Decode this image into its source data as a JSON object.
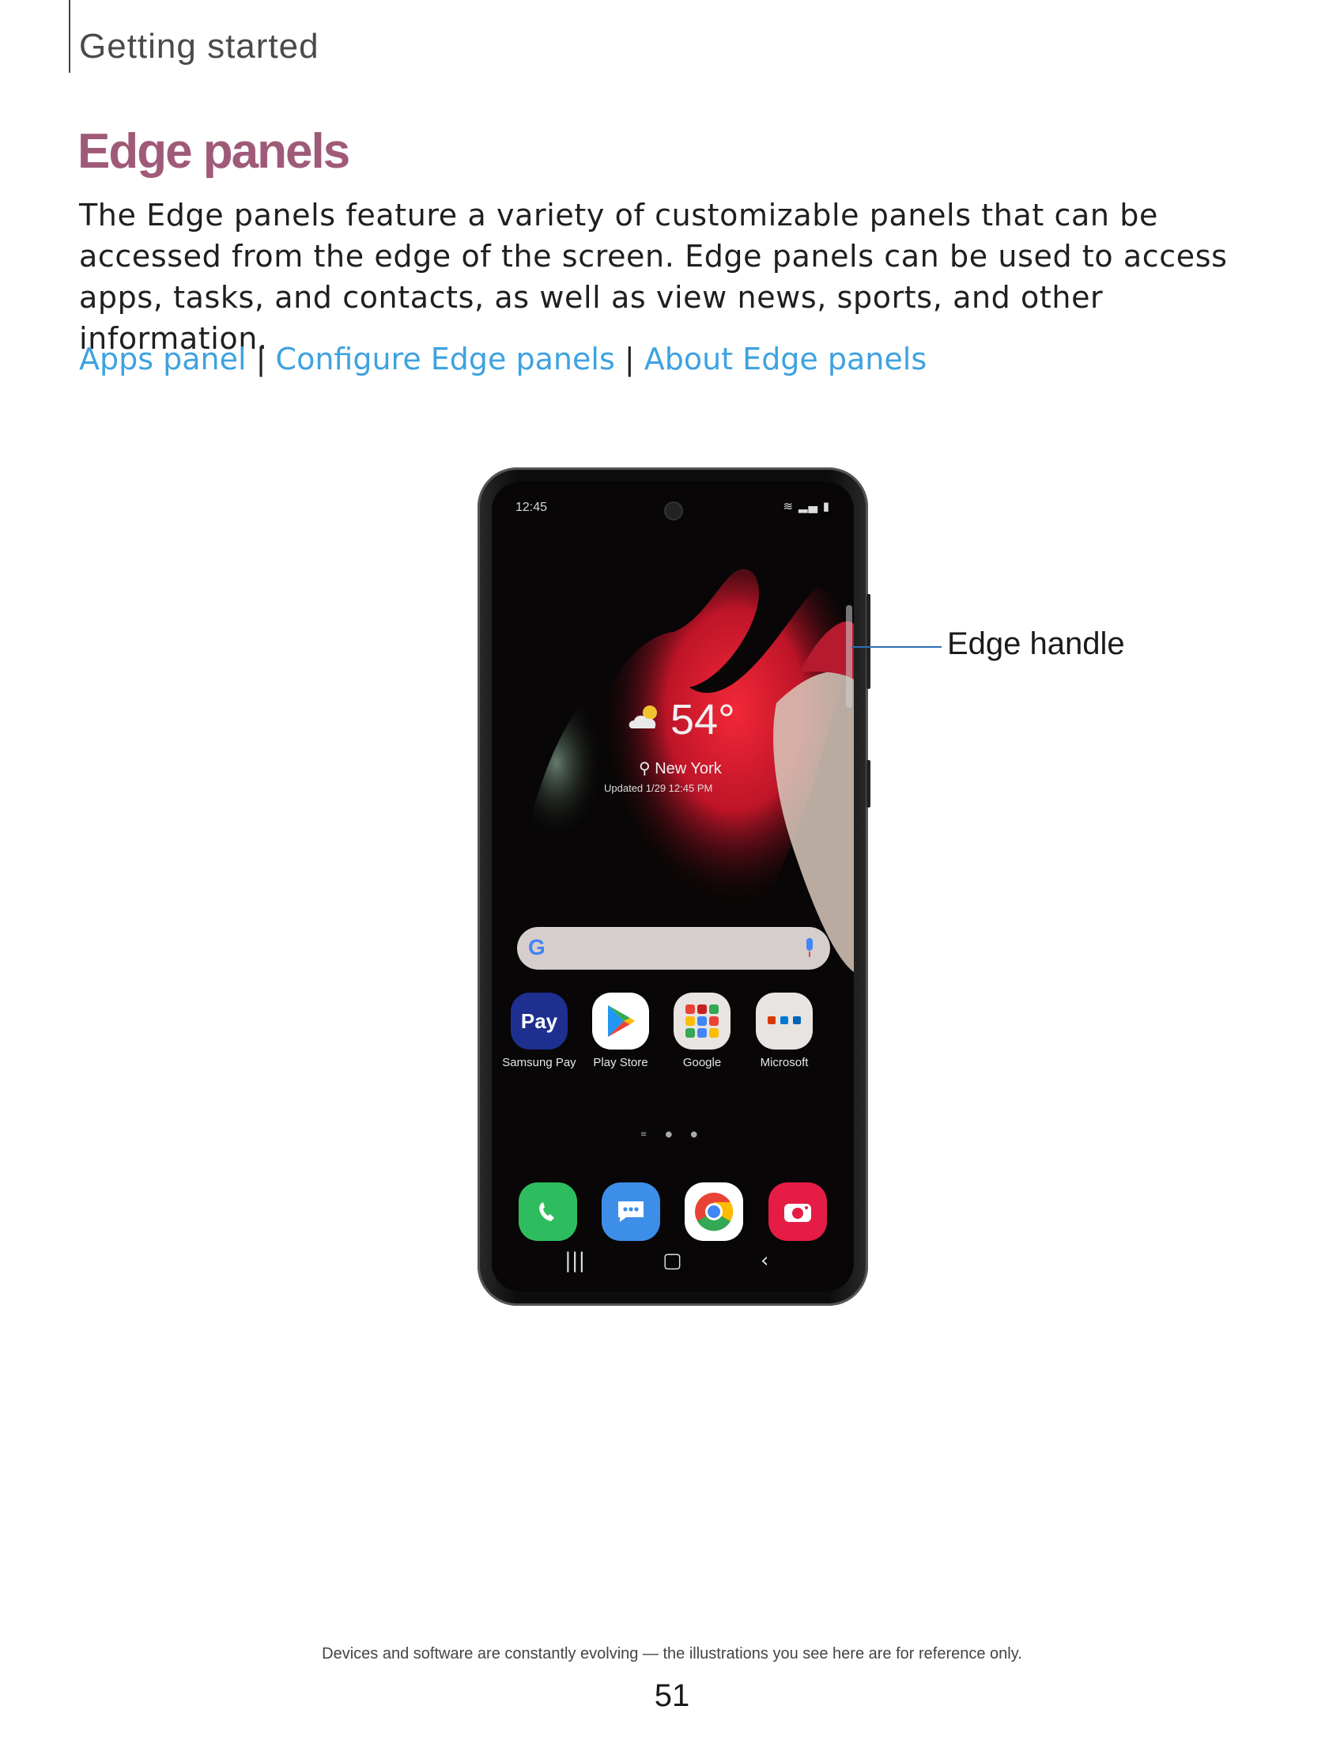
{
  "header": {
    "section": "Getting started"
  },
  "title": "Edge panels",
  "intro": "The Edge panels feature a variety of customizable panels that can be accessed from the edge of the screen. Edge panels can be used to access apps, tasks, and contacts, as well as view news, sports, and other information.",
  "links": {
    "items": [
      "Apps panel",
      "Configure Edge panels",
      "About Edge panels"
    ],
    "separator": "|"
  },
  "phone": {
    "status_time": "12:45",
    "weather": {
      "temperature": "54°",
      "city": "New York",
      "updated": "Updated 1/29 12:45 PM"
    },
    "search": {
      "logo": "G"
    },
    "apps": [
      {
        "label": "Samsung Pay",
        "icon_text": "Pay",
        "icon": "samsung-pay-icon",
        "color": "#1d2f8f"
      },
      {
        "label": "Play Store",
        "icon": "play-store-icon",
        "color": "#ffffff"
      },
      {
        "label": "Google",
        "icon": "google-folder-icon",
        "color": "#e8e4e2"
      },
      {
        "label": "Microsoft",
        "icon": "microsoft-folder-icon",
        "color": "#e8e4e2"
      }
    ],
    "dock": [
      {
        "icon": "phone-icon",
        "color": "#2ebd5e"
      },
      {
        "icon": "messages-icon",
        "color": "#3d8ee8"
      },
      {
        "icon": "chrome-icon",
        "color": "#ffffff"
      },
      {
        "icon": "camera-icon",
        "color": "#e51c45"
      }
    ]
  },
  "callout": {
    "label": "Edge handle"
  },
  "footer": {
    "note": "Devices and software are constantly evolving — the illustrations you see here are for reference only.",
    "page_number": "51"
  },
  "colors": {
    "title": "#a05a79",
    "link": "#3ea2e0",
    "callout_line": "#2f6fb5"
  }
}
